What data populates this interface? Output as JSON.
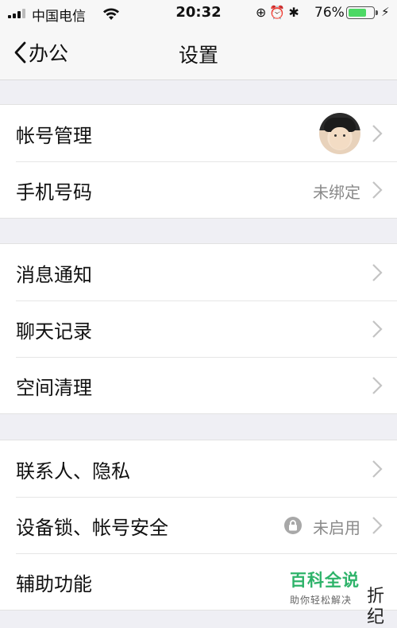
{
  "status_bar": {
    "carrier": "中国电信",
    "time": "20:32",
    "icons": [
      "orientation-lock-icon",
      "alarm-icon",
      "bluetooth-icon"
    ],
    "battery_percent_text": "76%",
    "battery_level": 0.76
  },
  "nav": {
    "back_label": "办公",
    "title": "设置"
  },
  "groups": [
    {
      "rows": [
        {
          "label": "帐号管理",
          "accessory": "avatar"
        },
        {
          "label": "手机号码",
          "value": "未绑定"
        }
      ]
    },
    {
      "rows": [
        {
          "label": "消息通知"
        },
        {
          "label": "聊天记录"
        },
        {
          "label": "空间清理"
        }
      ]
    },
    {
      "rows": [
        {
          "label": "联系人、隐私"
        },
        {
          "label": "设备锁、帐号安全",
          "value": "未启用",
          "icon": "lock-icon"
        },
        {
          "label": "辅助功能"
        }
      ]
    }
  ],
  "watermark": {
    "brand": "百科全说",
    "slogan": "助你轻松解决",
    "corner_text": "折\n纪"
  },
  "colors": {
    "background": "#efeff4",
    "battery_fill": "#4cd964",
    "watermark_green": "#2eb36a",
    "secondary_text": "#8a8a8a"
  }
}
